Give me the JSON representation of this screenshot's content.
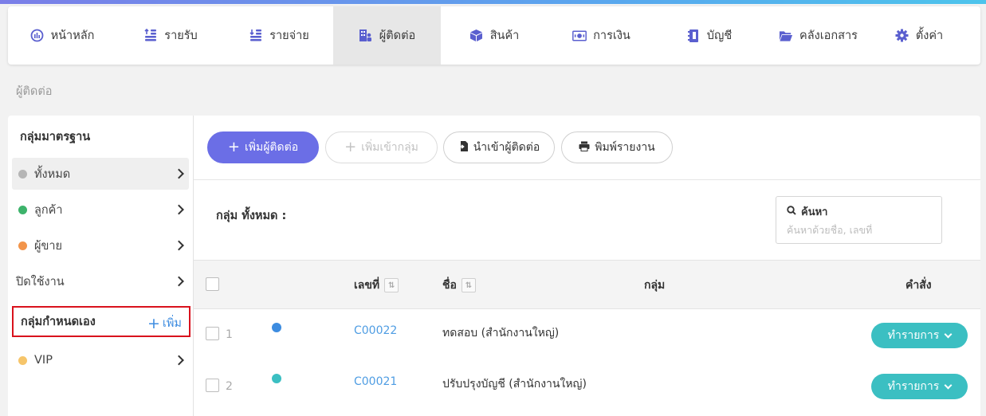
{
  "colors": {
    "accent": "#6b6ee6",
    "nav_icon": "#5a5fcf",
    "link": "#4f9de3",
    "action": "#3bbfc2",
    "highlight_border": "#d9121d"
  },
  "nav": {
    "items": [
      {
        "label": "หน้าหลัก",
        "icon": "dashboard-icon"
      },
      {
        "label": "รายรับ",
        "icon": "income-icon"
      },
      {
        "label": "รายจ่าย",
        "icon": "expense-icon"
      },
      {
        "label": "ผู้ติดต่อ",
        "icon": "contacts-building-icon",
        "active": true
      },
      {
        "label": "สินค้า",
        "icon": "box-icon"
      },
      {
        "label": "การเงิน",
        "icon": "money-icon"
      },
      {
        "label": "บัญชี",
        "icon": "ledger-icon"
      },
      {
        "label": "คลังเอกสาร",
        "icon": "folder-icon"
      },
      {
        "label": "ตั้งค่า",
        "icon": "gear-icon"
      }
    ]
  },
  "breadcrumb": "ผู้ติดต่อ",
  "sidebar": {
    "standard_title": "กลุ่มมาตรฐาน",
    "items": [
      {
        "label": "ทั้งหมด",
        "dot": "#b5b5b5"
      },
      {
        "label": "ลูกค้า",
        "dot": "#3db36b"
      },
      {
        "label": "ผู้ขาย",
        "dot": "#f2944a"
      },
      {
        "label": "ปิดใช้งาน",
        "dot": null
      }
    ],
    "custom_title": "กลุ่มกำหนดเอง",
    "custom_add": "เพิ่ม",
    "custom_items": [
      {
        "label": "VIP",
        "dot": "#f6c56a"
      }
    ]
  },
  "toolbar": {
    "add_contact": "เพิ่มผู้ติดต่อ",
    "add_to_group": "เพิ่มเข้ากลุ่ม",
    "import_contacts": "นำเข้าผู้ติดต่อ",
    "print_report": "พิมพ์รายงาน"
  },
  "group_heading": "กลุ่ม ทั้งหมด :",
  "search": {
    "label": "ค้นหา",
    "placeholder": "ค้นหาด้วยชื่อ, เลขที่"
  },
  "table": {
    "columns": {
      "number": "เลขที่",
      "name": "ชื่อ",
      "group": "กลุ่ม",
      "command": "คำสั่ง"
    },
    "rows": [
      {
        "index": "1",
        "dot": "#3d8ce0",
        "code": "C00022",
        "name": "ทดสอบ (สำนักงานใหญ่)",
        "action": "ทำรายการ"
      },
      {
        "index": "2",
        "dot": "#3bbfc2",
        "code": "C00021",
        "name": "ปรับปรุงบัญชี (สำนักงานใหญ่)",
        "action": "ทำรายการ"
      }
    ]
  }
}
